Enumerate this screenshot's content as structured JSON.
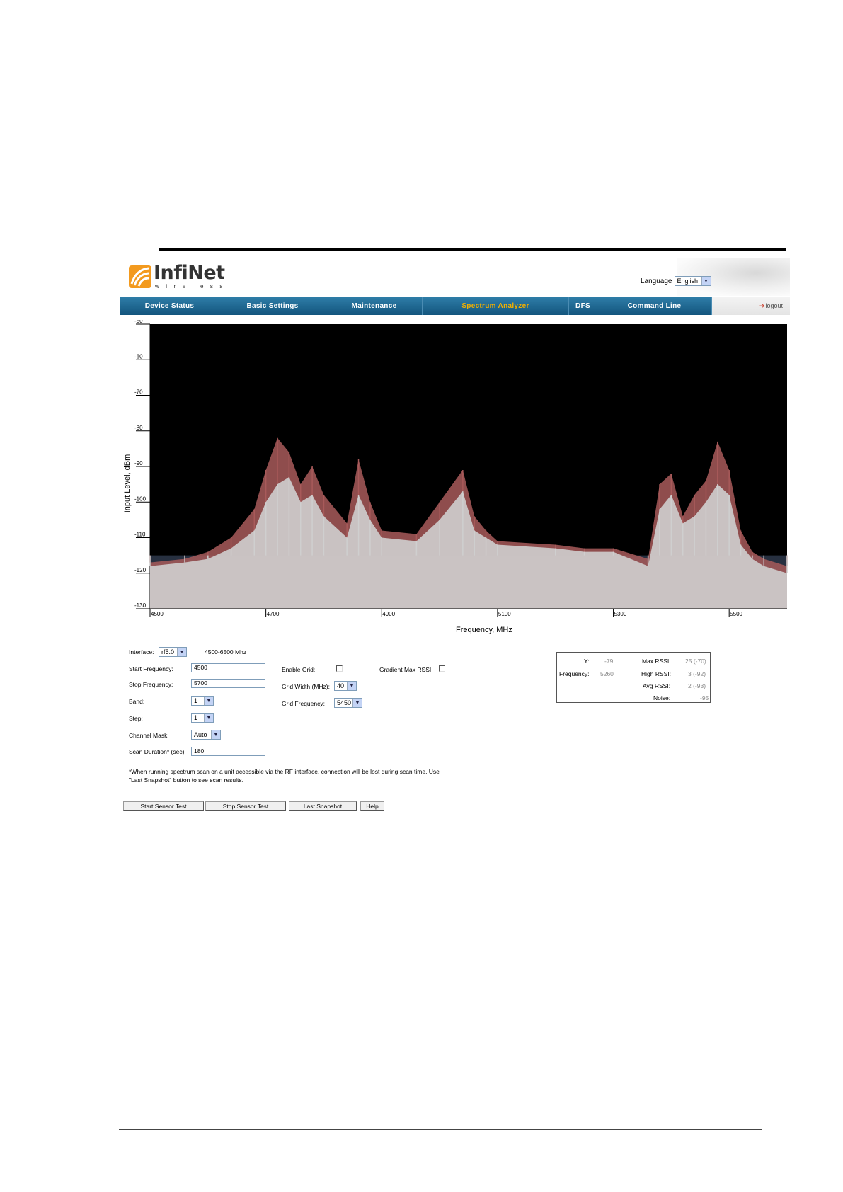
{
  "header": {
    "logo": {
      "name": "InfiNet",
      "sub": "wireless"
    },
    "language_label": "Language",
    "language_value": "English"
  },
  "nav": {
    "items": [
      {
        "label": "Device Status"
      },
      {
        "label": "Basic Settings"
      },
      {
        "label": "Maintenance"
      },
      {
        "label": "Spectrum Analyzer",
        "active": true
      },
      {
        "label": "DFS"
      },
      {
        "label": "Command Line"
      }
    ],
    "logout": "logout"
  },
  "chart_data": {
    "type": "area",
    "xlabel": "Frequency, MHz",
    "ylabel": "Input Level, dBm",
    "xlim": [
      4500,
      5600
    ],
    "ylim": [
      -130,
      -50
    ],
    "x_ticks": [
      4500,
      4700,
      4900,
      5100,
      5300,
      5500
    ],
    "y_ticks": [
      -50,
      -60,
      -70,
      -80,
      -90,
      -100,
      -110,
      -120,
      -130
    ],
    "background": "#000000",
    "noise_color": "#273040",
    "avg_color": "#cfcfcf",
    "max_color": "#a85a5a",
    "series": [
      {
        "name": "",
        "x": [
          4500,
          4560,
          4600,
          4640,
          4680,
          4700,
          4720,
          4740,
          4760,
          4780,
          4800,
          4840,
          4860,
          4880,
          4900,
          4960,
          5000,
          5040,
          5060,
          5080,
          5100,
          5200,
          5250,
          5300,
          5360,
          5380,
          5400,
          5420,
          5440,
          5460,
          5480,
          5500,
          5520,
          5540,
          5560,
          5600
        ],
        "values": [
          -118,
          -117,
          -116,
          -113,
          -108,
          -100,
          -95,
          -93,
          -100,
          -98,
          -104,
          -110,
          -98,
          -105,
          -110,
          -111,
          -105,
          -97,
          -108,
          -110,
          -112,
          -113,
          -114,
          -114,
          -118,
          -102,
          -98,
          -106,
          -104,
          -100,
          -95,
          -98,
          -112,
          -116,
          -118,
          -120
        ]
      },
      {
        "name": "",
        "x": [
          4500,
          4560,
          4600,
          4640,
          4680,
          4700,
          4720,
          4740,
          4760,
          4780,
          4800,
          4840,
          4860,
          4880,
          4900,
          4960,
          5000,
          5040,
          5060,
          5080,
          5100,
          5200,
          5250,
          5300,
          5360,
          5380,
          5400,
          5420,
          5440,
          5460,
          5480,
          5500,
          5520,
          5540,
          5560,
          5600
        ],
        "values": [
          -117,
          -116,
          -114,
          -110,
          -102,
          -91,
          -82,
          -86,
          -95,
          -90,
          -98,
          -106,
          -88,
          -100,
          -108,
          -109,
          -100,
          -91,
          -104,
          -108,
          -111,
          -112,
          -113,
          -113,
          -116,
          -95,
          -92,
          -104,
          -98,
          -94,
          -83,
          -91,
          -108,
          -114,
          -116,
          -118
        ]
      }
    ]
  },
  "form": {
    "interface_label": "Interface:",
    "interface_value": "rf5.0",
    "range_text": "4500-6500 Mhz",
    "start_freq_label": "Start Frequency:",
    "start_freq_value": "4500",
    "stop_freq_label": "Stop Frequency:",
    "stop_freq_value": "5700",
    "band_label": "Band:",
    "band_value": "1",
    "step_label": "Step:",
    "step_value": "1",
    "channel_mask_label": "Channel Mask:",
    "channel_mask_value": "Auto",
    "scan_duration_label": "Scan Duration* (sec):",
    "scan_duration_value": "180",
    "enable_grid_label": "Enable Grid:",
    "grid_width_label": "Grid Width (MHz):",
    "grid_width_value": "40",
    "grid_freq_label": "Grid Frequency:",
    "grid_freq_value": "5450",
    "gradient_label": "Gradient Max RSSI",
    "note_line1": "*When running spectrum scan on a unit accessible via the RF interface, connection will be lost during scan time. Use",
    "note_line2": "\"Last Snapshot\" button to see scan results."
  },
  "info": {
    "y_label": "Y:",
    "y_value": "-79",
    "freq_label": "Frequency:",
    "freq_value": "5260",
    "max_rssi_label": "Max RSSI:",
    "max_rssi_value": "25 (-70)",
    "high_rssi_label": "High RSSI:",
    "high_rssi_value": "3 (-92)",
    "avg_rssi_label": "Avg RSSI:",
    "avg_rssi_value": "2 (-93)",
    "noise_label": "Noise:",
    "noise_value": "-95"
  },
  "buttons": {
    "start": "Start Sensor Test",
    "stop": "Stop Sensor Test",
    "snapshot": "Last Snapshot",
    "help": "Help"
  }
}
